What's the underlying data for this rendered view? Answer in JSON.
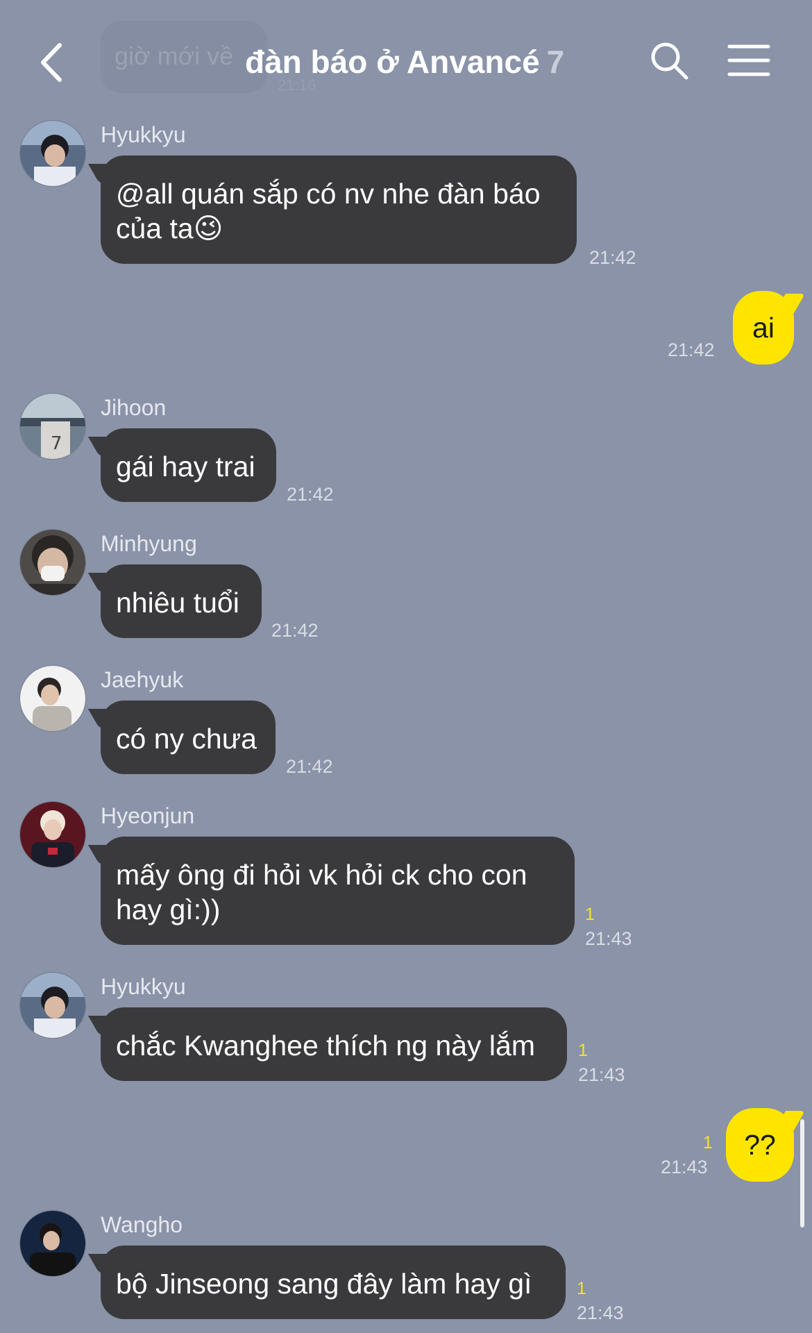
{
  "header": {
    "title": "đàn báo ở Anvancé",
    "member_count": "7",
    "faded_message": "giờ mới về",
    "faded_time": "21:16"
  },
  "messages": [
    {
      "sender": "Hyukkyu",
      "text": "@all quán sắp có nv nhe đàn báo của ta😉",
      "time": "21:42",
      "unread": ""
    },
    {
      "sender": "me",
      "text": "ai",
      "time": "21:42",
      "unread": ""
    },
    {
      "sender": "Jihoon",
      "text": "gái hay trai",
      "time": "21:42",
      "unread": ""
    },
    {
      "sender": "Minhyung",
      "text": "nhiêu tuổi",
      "time": "21:42",
      "unread": ""
    },
    {
      "sender": "Jaehyuk",
      "text": "có ny chưa",
      "time": "21:42",
      "unread": ""
    },
    {
      "sender": "Hyeonjun",
      "text": "mấy ông đi hỏi vk hỏi ck cho con hay gì:))",
      "time": "21:43",
      "unread": "1"
    },
    {
      "sender": "Hyukkyu",
      "text": "chắc Kwanghee thích ng này lắm",
      "time": "21:43",
      "unread": "1"
    },
    {
      "sender": "me",
      "text": "??",
      "time": "21:43",
      "unread": "1"
    },
    {
      "sender": "Wangho",
      "text": "bộ Jinseong sang đây làm hay gì",
      "time": "21:43",
      "unread": "1"
    }
  ],
  "colors": {
    "background": "#8a93a8",
    "bubble_other": "#3a3a3c",
    "bubble_me": "#fee500",
    "unread": "#f5e425"
  },
  "icons": [
    "back-arrow-icon",
    "search-icon",
    "menu-icon"
  ]
}
